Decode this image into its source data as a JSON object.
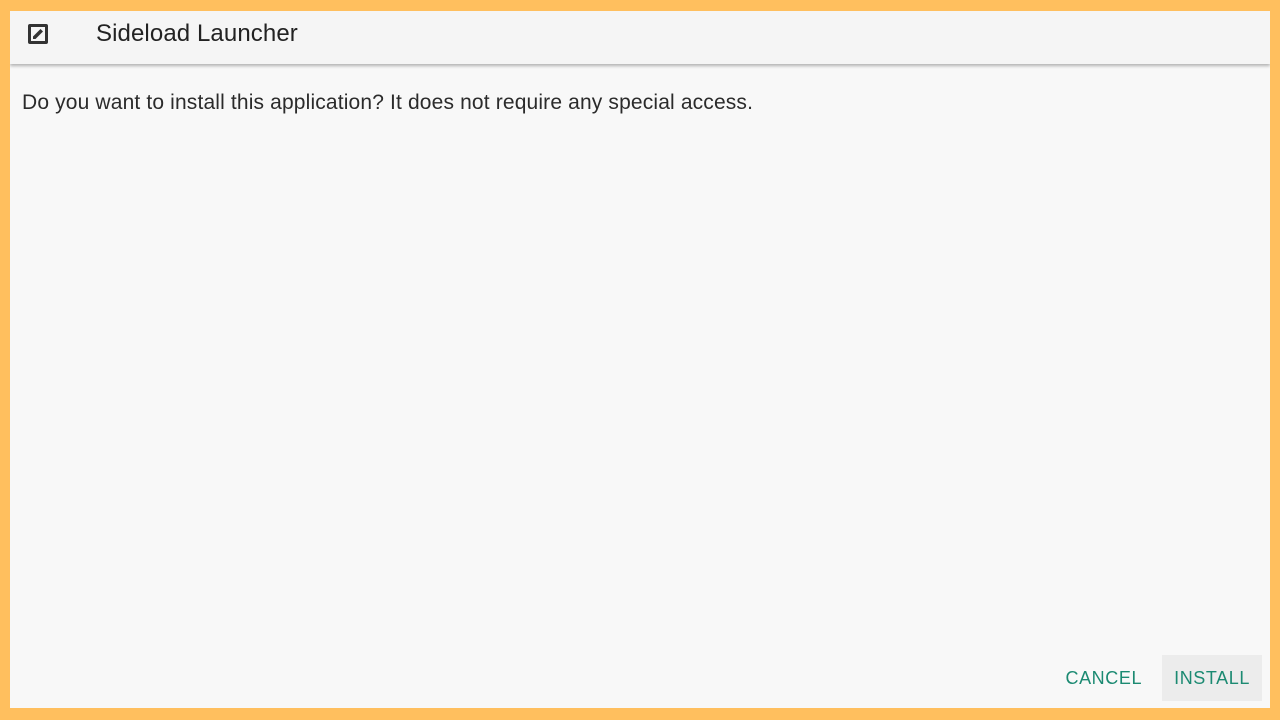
{
  "app_bar": {
    "title": "Sideload Launcher",
    "icon": "edit-box-icon"
  },
  "dialog": {
    "message": "Do you want to install this application? It does not require any special access."
  },
  "actions": {
    "cancel_label": "CANCEL",
    "install_label": "INSTALL"
  },
  "colors": {
    "frame": "#ffbf5e",
    "background": "#f8f8f8",
    "app_bar": "#f5f5f5",
    "accent": "#1c8a72",
    "text": "#222222"
  }
}
